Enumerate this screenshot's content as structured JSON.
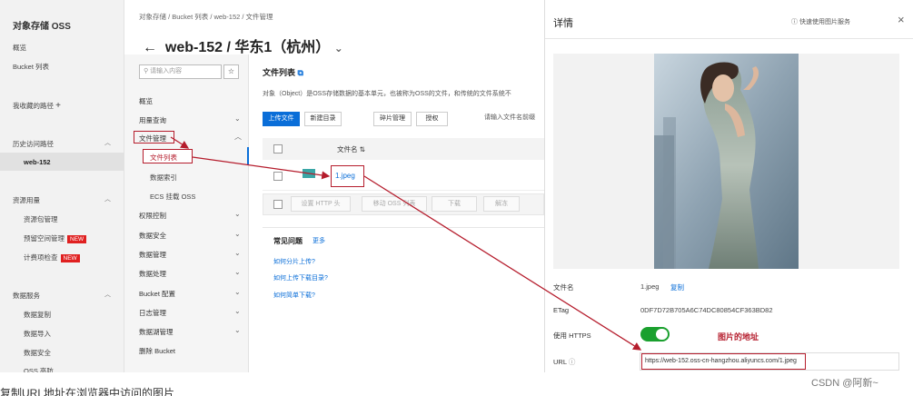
{
  "sidebar": {
    "title": "对象存储 OSS",
    "items": [
      {
        "label": "概览"
      },
      {
        "label": "Bucket 列表"
      },
      {
        "label": "我收藏的路径",
        "plus": "+"
      },
      {
        "label": "历史访问路径"
      },
      {
        "label": "web-152"
      },
      {
        "label": "资源用量"
      },
      {
        "label": "资源包管理"
      },
      {
        "label": "预留空间管理",
        "badge": "NEW"
      },
      {
        "label": "计费项检查",
        "badge": "NEW"
      },
      {
        "label": "数据服务"
      },
      {
        "label": "数据复制"
      },
      {
        "label": "数据导入"
      },
      {
        "label": "数据安全"
      },
      {
        "label": "OSS 高防"
      }
    ],
    "collapse_glyph": "‹"
  },
  "breadcrumb": "对象存储 / Bucket 列表 / web-152 / 文件管理",
  "page_title": "web-152 / 华东1（杭州）",
  "back_glyph": "←",
  "title_chevron": "⌄",
  "search": {
    "placeholder": "请输入内容",
    "star": "☆"
  },
  "nav2": [
    {
      "label": "概览"
    },
    {
      "label": "用量查询"
    },
    {
      "label": "文件管理"
    },
    {
      "label": "文件列表"
    },
    {
      "label": "数据索引"
    },
    {
      "label": "ECS 挂载 OSS"
    },
    {
      "label": "权限控制"
    },
    {
      "label": "数据安全"
    },
    {
      "label": "数据管理"
    },
    {
      "label": "数据处理"
    },
    {
      "label": "Bucket 配置"
    },
    {
      "label": "日志管理"
    },
    {
      "label": "数据湖管理"
    },
    {
      "label": "删除 Bucket"
    }
  ],
  "file_list": {
    "title": "文件列表",
    "description": "对象（Object）是OSS存储数据的基本单元，也被称为OSS的文件，和传统的文件系统不",
    "buttons": [
      "上传文件",
      "新建目录",
      "碎片管理",
      "授权",
      "请输入文件名前缀"
    ],
    "column_header": "文件名",
    "file_name": "1.jpeg",
    "actions": [
      "设置 HTTP 头",
      "移动 OSS 列表",
      "下载",
      "解冻"
    ],
    "faq_title": "常见问题",
    "faq_more": "更多",
    "faq_links": [
      "如何分片上传?",
      "如何上传下载目录?",
      "如何简单下载?"
    ]
  },
  "detail_panel": {
    "title": "详情",
    "help": "快速使用图片服务",
    "close": "×",
    "file_name_label": "文件名",
    "file_name_value": "1.jpeg",
    "copy_label": "复制",
    "etag_label": "ETag",
    "etag_value": "0DF7D72B705A6C74DC80854CF363BD82",
    "https_label": "使用 HTTPS",
    "https_enabled": true,
    "url_label": "URL",
    "url_value": "https://web-152.oss-cn-hangzhou.aliyuncs.com/1.jpeg",
    "annotation": "图片的地址"
  },
  "watermark": "CSDN @阿新~",
  "bottom_text": "复制URL地址在浏览器中访问的图片"
}
